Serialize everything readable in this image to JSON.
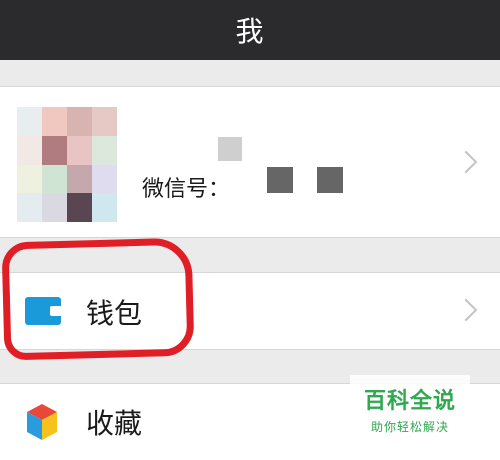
{
  "header": {
    "title": "我"
  },
  "profile": {
    "wechat_id_label": "微信号："
  },
  "menu": {
    "wallet": {
      "label": "钱包",
      "icon": "wallet-icon"
    },
    "favorites": {
      "label": "收藏",
      "icon": "favorites-cube-icon"
    }
  },
  "watermark": {
    "main": "百科全说",
    "sub": "助你轻松解决"
  },
  "colors": {
    "header_bg": "#2b2b2d",
    "wallet_icon": "#1b9ad9",
    "highlight": "#e01e26",
    "watermark": "#2fa84f"
  }
}
